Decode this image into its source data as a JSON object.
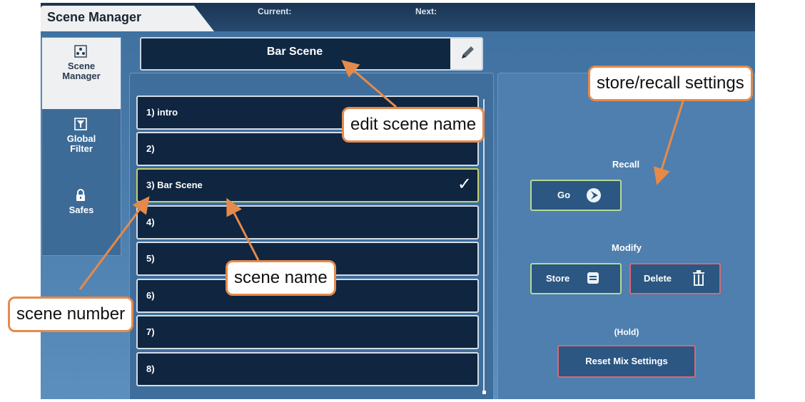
{
  "header": {
    "title": "Scene Manager",
    "current_label": "Current:",
    "next_label": "Next:"
  },
  "sidebar": {
    "items": [
      {
        "label": "Scene Manager",
        "icon": "scene-manager-icon"
      },
      {
        "label": "Global Filter",
        "icon": "filter-icon"
      },
      {
        "label": "Safes",
        "icon": "lock-icon"
      }
    ]
  },
  "scene": {
    "name": "Bar Scene"
  },
  "scenes": [
    "1) intro",
    "2)",
    "3) Bar Scene",
    "4)",
    "5)",
    "6)",
    "7)",
    "8)"
  ],
  "selected_scene_index": 2,
  "right_panel": {
    "recall_label": "Recall",
    "go_label": "Go",
    "modify_label": "Modify",
    "store_label": "Store",
    "delete_label": "Delete",
    "hold_label": "(Hold)",
    "reset_label": "Reset Mix Settings"
  },
  "annotations": {
    "edit_scene_name": "edit scene name",
    "store_recall": "store/recall settings",
    "scene_name": "scene name",
    "scene_number": "scene number"
  },
  "colors": {
    "annotation_orange": "#e58a4b",
    "row_bg": "#0f2540",
    "selected_border": "#c7cf69"
  }
}
